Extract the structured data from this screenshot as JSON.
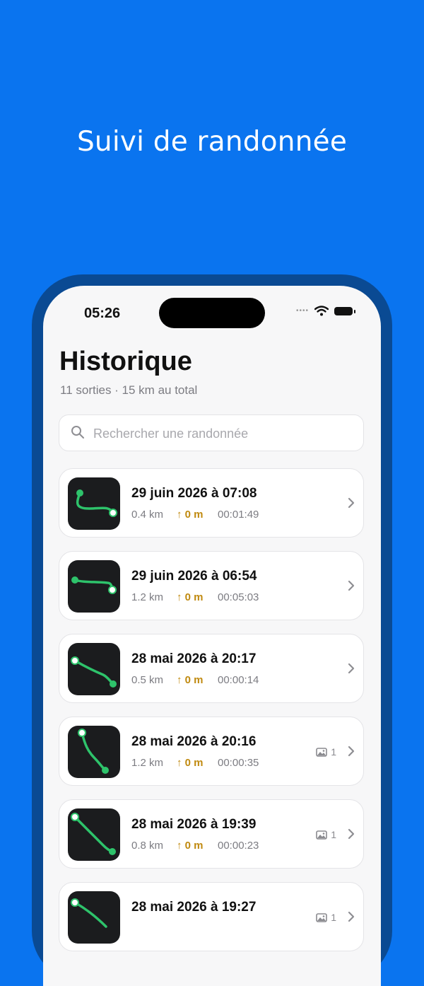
{
  "headline": "Suivi de randonnée",
  "status_bar": {
    "time": "05:26"
  },
  "header": {
    "title": "Historique",
    "subtitle": "11 sorties · 15 km au total"
  },
  "search": {
    "placeholder": "Rechercher une randonnée",
    "value": ""
  },
  "colors": {
    "background": "#0a74ef",
    "track": "#2ec36b",
    "elevation": "#c08a10",
    "thumbnail": "#1b1c1e"
  },
  "hikes": [
    {
      "title": "29 juin 2026 à 07:08",
      "distance": "0.4 km",
      "elevation": "↑ 0 m",
      "duration": "00:01:49",
      "photos": ""
    },
    {
      "title": "29 juin 2026 à 06:54",
      "distance": "1.2 km",
      "elevation": "↑ 0 m",
      "duration": "00:05:03",
      "photos": ""
    },
    {
      "title": "28 mai 2026 à 20:17",
      "distance": "0.5 km",
      "elevation": "↑ 0 m",
      "duration": "00:00:14",
      "photos": ""
    },
    {
      "title": "28 mai 2026 à 20:16",
      "distance": "1.2 km",
      "elevation": "↑ 0 m",
      "duration": "00:00:35",
      "photos": "1"
    },
    {
      "title": "28 mai 2026 à 19:39",
      "distance": "0.8 km",
      "elevation": "↑ 0 m",
      "duration": "00:00:23",
      "photos": "1"
    },
    {
      "title": "28 mai 2026 à 19:27",
      "distance": "",
      "elevation": "",
      "duration": "",
      "photos": "1"
    }
  ]
}
